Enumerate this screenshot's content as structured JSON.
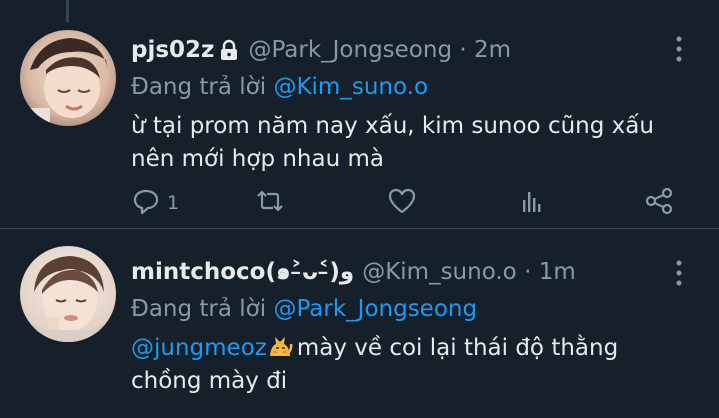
{
  "colors": {
    "background": "#15202b",
    "text_primary": "#e7e9ea",
    "text_secondary": "#8b98a5",
    "mention": "#1d9bf0",
    "divider": "#38444d"
  },
  "tweets": [
    {
      "display_name": "pjs02z",
      "protected_icon": "lock-icon",
      "handle": "@Park_Jongseong",
      "separator": "·",
      "time": "2m",
      "reply_prefix": "Đang trả lời",
      "reply_to": "@Kim_suno.o",
      "body_line1": "ừ tại prom năm nay xấu, kim sunoo cũng xấu",
      "body_line2": "nên mới hợp nhau mà",
      "actions": {
        "reply_icon": "reply-icon",
        "reply_count": "1",
        "retweet_icon": "retweet-icon",
        "like_icon": "heart-icon",
        "stats_icon": "analytics-icon",
        "share_icon": "share-icon"
      },
      "more_icon": "more-vertical-icon"
    },
    {
      "display_name": "mintchoco(๑˃̵ᴗ˂̵)و",
      "handle": "@Kim_suno.o",
      "separator": "·",
      "time": "1m",
      "reply_prefix": "Đang trả lời",
      "reply_to": "@Park_Jongseong",
      "body_mention": "@jungmeoz",
      "body_emoji": "cat-emoji",
      "body_line1_rest": "mày về coi lại thái độ thằng",
      "body_line2": "chồng mày đi",
      "more_icon": "more-vertical-icon"
    }
  ]
}
